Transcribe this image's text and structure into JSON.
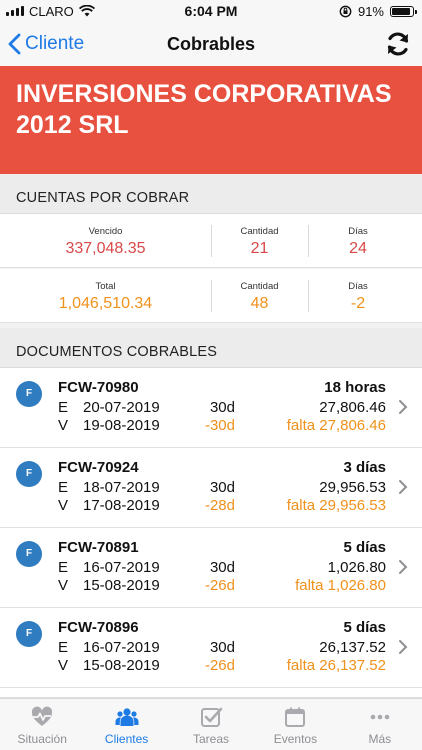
{
  "status_bar": {
    "carrier": "CLARO",
    "time": "6:04 PM",
    "battery": "91%",
    "battery_level": 0.91
  },
  "nav": {
    "back_label": "Cliente",
    "title": "Cobrables",
    "refresh_icon": "refresh-icon"
  },
  "client": {
    "name_line1": "INVERSIONES CORPORATIVAS",
    "name_line2": "2012 SRL"
  },
  "receivables": {
    "heading": "CUENTAS POR COBRAR",
    "overdue": {
      "label": "Vencido",
      "value": "337,048.35",
      "qty_label": "Cantidad",
      "qty": "21",
      "days_label": "Días",
      "days": "24"
    },
    "total": {
      "label": "Total",
      "value": "1,046,510.34",
      "qty_label": "Cantidad",
      "qty": "48",
      "days_label": "Días",
      "days": "-2"
    }
  },
  "documents": {
    "heading": "DOCUMENTOS COBRABLES",
    "items": [
      {
        "badge": "F",
        "number": "FCW-70980",
        "age": "18 horas",
        "e_label": "E",
        "e_date": "20-07-2019",
        "e_term": "30d",
        "e_amount": "27,806.46",
        "v_label": "V",
        "v_date": "19-08-2019",
        "v_term": "-30d",
        "v_amount": "falta 27,806.46"
      },
      {
        "badge": "F",
        "number": "FCW-70924",
        "age": "3 días",
        "e_label": "E",
        "e_date": "18-07-2019",
        "e_term": "30d",
        "e_amount": "29,956.53",
        "v_label": "V",
        "v_date": "17-08-2019",
        "v_term": "-28d",
        "v_amount": "falta 29,956.53"
      },
      {
        "badge": "F",
        "number": "FCW-70891",
        "age": "5 días",
        "e_label": "E",
        "e_date": "16-07-2019",
        "e_term": "30d",
        "e_amount": "1,026.80",
        "v_label": "V",
        "v_date": "15-08-2019",
        "v_term": "-26d",
        "v_amount": "falta 1,026.80"
      },
      {
        "badge": "F",
        "number": "FCW-70896",
        "age": "5 días",
        "e_label": "E",
        "e_date": "16-07-2019",
        "e_term": "30d",
        "e_amount": "26,137.52",
        "v_label": "V",
        "v_date": "15-08-2019",
        "v_term": "-26d",
        "v_amount": "falta 26,137.52"
      }
    ]
  },
  "tabs": [
    {
      "label": "Situación",
      "icon": "heartbeat-icon"
    },
    {
      "label": "Clientes",
      "icon": "users-icon",
      "active": true
    },
    {
      "label": "Tareas",
      "icon": "checkbox-icon"
    },
    {
      "label": "Eventos",
      "icon": "calendar-icon"
    },
    {
      "label": "Más",
      "icon": "more-icon"
    }
  ],
  "colors": {
    "accent": "#1e7be6",
    "header": "#e8503f",
    "overdue": "#d94848",
    "warning": "#f0911b",
    "badge": "#2f7cc1"
  }
}
